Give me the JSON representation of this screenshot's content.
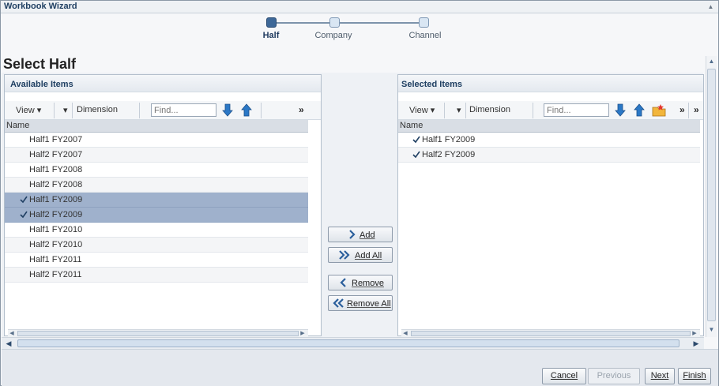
{
  "window": {
    "title": "Workbook Wizard"
  },
  "train": {
    "steps": [
      {
        "label": "Half",
        "state": "active"
      },
      {
        "label": "Company",
        "state": "idle"
      },
      {
        "label": "Channel",
        "state": "idle"
      }
    ]
  },
  "page": {
    "title": "Select Half"
  },
  "available": {
    "title": "Available Items",
    "toolbar": {
      "view_label": "View",
      "dimension_label": "Dimension",
      "find_placeholder": "Find..."
    },
    "column_header": "Name",
    "rows": [
      {
        "label": "Half1 FY2007",
        "selected": false
      },
      {
        "label": "Half2 FY2007",
        "selected": false
      },
      {
        "label": "Half1 FY2008",
        "selected": false
      },
      {
        "label": "Half2 FY2008",
        "selected": false
      },
      {
        "label": "Half1 FY2009",
        "selected": true
      },
      {
        "label": "Half2 FY2009",
        "selected": true
      },
      {
        "label": "Half1 FY2010",
        "selected": false
      },
      {
        "label": "Half2 FY2010",
        "selected": false
      },
      {
        "label": "Half1 FY2011",
        "selected": false
      },
      {
        "label": "Half2 FY2011",
        "selected": false
      }
    ]
  },
  "selected": {
    "title": "Selected Items",
    "toolbar": {
      "view_label": "View",
      "dimension_label": "Dimension",
      "find_placeholder": "Find..."
    },
    "column_header": "Name",
    "rows": [
      {
        "label": "Half1 FY2009",
        "checked": true
      },
      {
        "label": "Half2 FY2009",
        "checked": true
      }
    ]
  },
  "shuttle": {
    "add": "Add",
    "add_all": "Add All",
    "remove": "Remove",
    "remove_all": "Remove All"
  },
  "footer": {
    "cancel": "Cancel",
    "previous": "Previous",
    "next": "Next",
    "finish": "Finish"
  },
  "colors": {
    "accent": "#3e6898",
    "selection": "#9fb1cc",
    "arrow_blue": "#2b78c6"
  }
}
